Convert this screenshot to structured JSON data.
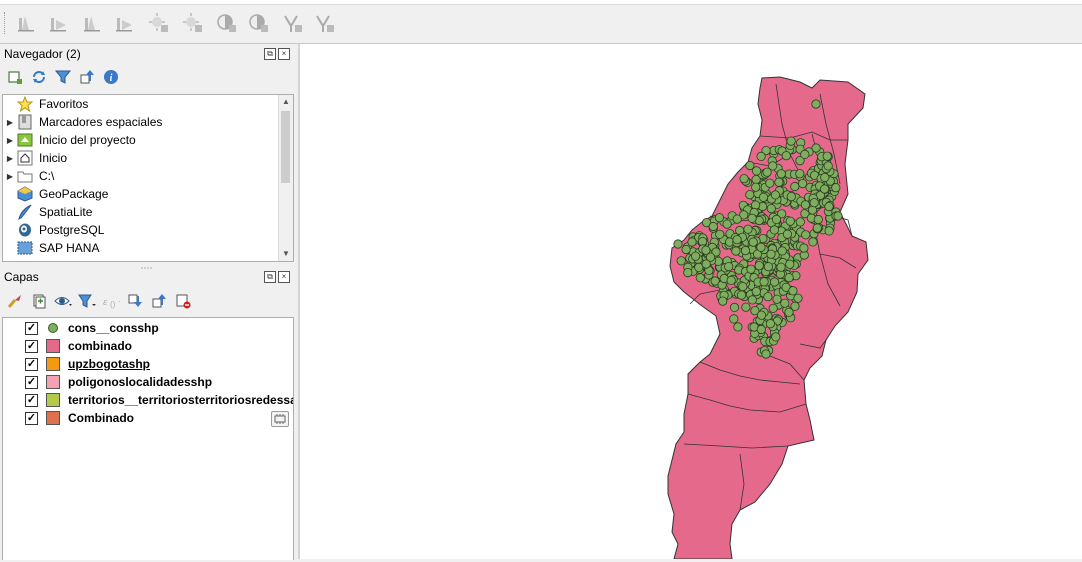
{
  "toolbar": {
    "icons": [
      "histogram-icon",
      "histogram-stretch-icon",
      "histogram-local-icon",
      "histogram-local-stretch-icon",
      "brightness-increase-icon",
      "brightness-decrease-icon",
      "contrast-increase-icon",
      "contrast-decrease-icon",
      "gamma-increase-icon",
      "gamma-decrease-icon"
    ]
  },
  "browser": {
    "title": "Navegador (2)",
    "tools": [
      "add-selected-layers-icon",
      "refresh-icon",
      "filter-icon",
      "collapse-all-icon",
      "properties-info-icon"
    ],
    "items": [
      {
        "label": "Favoritos",
        "icon": "star-icon",
        "expandable": false
      },
      {
        "label": "Marcadores espaciales",
        "icon": "bookmark-icon",
        "expandable": true
      },
      {
        "label": "Inicio del proyecto",
        "icon": "project-home-icon",
        "expandable": true
      },
      {
        "label": "Inicio",
        "icon": "home-icon",
        "expandable": true
      },
      {
        "label": "C:\\",
        "icon": "folder-icon",
        "expandable": true
      },
      {
        "label": "GeoPackage",
        "icon": "geopackage-icon",
        "expandable": false
      },
      {
        "label": "SpatiaLite",
        "icon": "spatialite-icon",
        "expandable": false
      },
      {
        "label": "PostgreSQL",
        "icon": "postgresql-icon",
        "expandable": false
      },
      {
        "label": "SAP HANA",
        "icon": "sap-hana-icon",
        "expandable": false
      }
    ]
  },
  "layers": {
    "title": "Capas",
    "tools": [
      "style-paint-icon",
      "add-group-icon",
      "visibility-eye-icon",
      "filter-legend-icon",
      "expression-filter-icon",
      "expand-all-icon",
      "collapse-all-icon",
      "remove-layer-icon"
    ],
    "items": [
      {
        "name": "cons__consshp",
        "symbol": "point",
        "color": "#7eae5e",
        "checked": true,
        "underlined": false
      },
      {
        "name": "combinado",
        "symbol": "fill",
        "color": "#e5698a",
        "checked": true,
        "underlined": false
      },
      {
        "name": "upzbogotashp",
        "symbol": "fill",
        "color": "#f39a12",
        "checked": true,
        "underlined": true
      },
      {
        "name": "poligonoslocalidadesshp",
        "symbol": "fill",
        "color": "#f4a2b1",
        "checked": true,
        "underlined": false
      },
      {
        "name": "territorios__territoriosterritoriosredessal",
        "symbol": "fill",
        "color": "#b3c94a",
        "checked": true,
        "underlined": false
      },
      {
        "name": "Combinado",
        "symbol": "fill",
        "color": "#e07050",
        "checked": true,
        "underlined": false
      }
    ]
  },
  "colors": {
    "polygon_fill": "#e5698a",
    "polygon_stroke": "#333333",
    "point_fill": "#7eae5e",
    "point_stroke": "#2a3a22"
  }
}
